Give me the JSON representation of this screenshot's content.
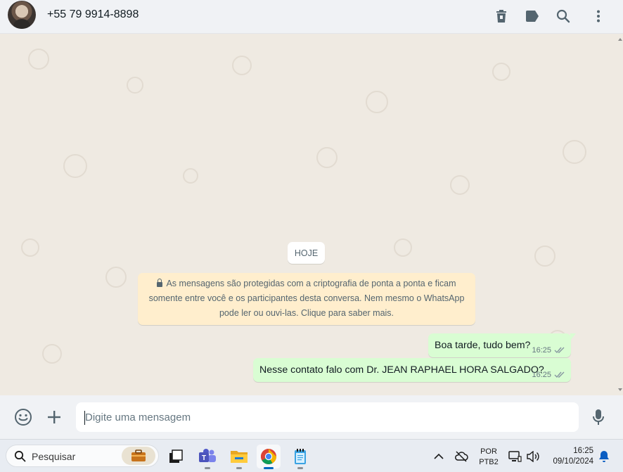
{
  "header": {
    "contact_name": "+55 79 9914-8898",
    "icons": [
      "trash-icon",
      "label-icon",
      "search-icon",
      "menu-icon"
    ]
  },
  "chat": {
    "date_chip": "HOJE",
    "encryption_notice": "As mensagens são protegidas com a criptografia de ponta a ponta e ficam somente entre você e os participantes desta conversa. Nem mesmo o WhatsApp pode ler ou ouvi-las. Clique para saber mais.",
    "messages": [
      {
        "text": "Boa tarde, tudo bem?",
        "time": "16:25",
        "status": "delivered"
      },
      {
        "text": "Nesse contato falo com Dr. JEAN RAPHAEL HORA SALGADO?",
        "time": "16:25",
        "status": "delivered"
      }
    ]
  },
  "composer": {
    "placeholder": "Digite uma mensagem",
    "value": "",
    "icons": [
      "emoji-icon",
      "plus-icon",
      "microphone-icon"
    ]
  },
  "taskbar": {
    "search_label": "Pesquisar",
    "apps": [
      "work-briefcase",
      "task-view",
      "teams",
      "file-explorer",
      "chrome",
      "notepad"
    ],
    "active_app": "chrome",
    "language_line1": "POR",
    "language_line2": "PTB2",
    "time": "16:25",
    "date": "09/10/2024"
  },
  "colors": {
    "header_bg": "#f0f2f5",
    "chat_bg": "#efeae2",
    "outgoing_bubble": "#d9fdd3",
    "notice_bg": "#ffeecd",
    "tick_color": "#8696a0",
    "taskbar_bg": "#e8ecf2"
  }
}
